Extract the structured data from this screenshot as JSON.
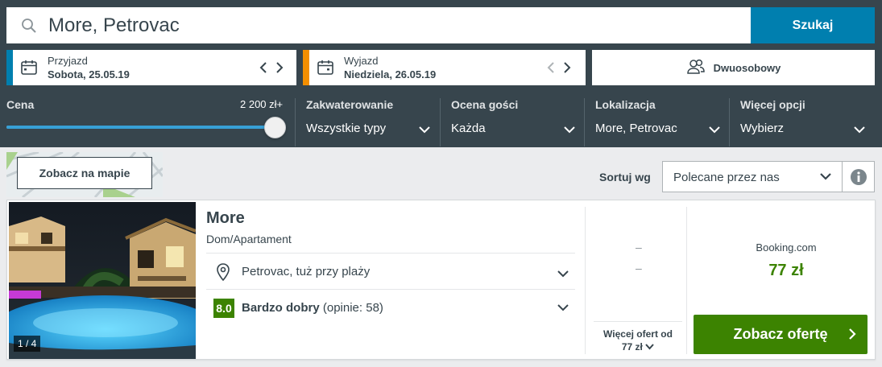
{
  "search": {
    "value": "More, Petrovac",
    "button_label": "Szukaj"
  },
  "checkin": {
    "label": "Przyjazd",
    "value": "Sobota, 25.05.19",
    "accent": "#007faf"
  },
  "checkout": {
    "label": "Wyjazd",
    "value": "Niedziela, 26.05.19",
    "accent": "#f48f00"
  },
  "room": {
    "label": "Dwuosobowy"
  },
  "filters": {
    "price": {
      "title": "Cena",
      "value": "2 200 zł+",
      "slider_level": 1.0
    },
    "accommodation": {
      "title": "Zakwaterowanie",
      "value": "Wszystkie typy"
    },
    "rating": {
      "title": "Ocena gości",
      "value": "Każda"
    },
    "location": {
      "title": "Lokalizacja",
      "value": "More, Petrovac"
    },
    "more": {
      "title": "Więcej opcji",
      "value": "Wybierz"
    }
  },
  "map": {
    "button_label": "Zobacz na mapie"
  },
  "sort": {
    "label": "Sortuj wg",
    "value": "Polecane przez nas"
  },
  "result": {
    "name": "More",
    "type": "Dom/Apartament",
    "photo_counter": "1 / 4",
    "location": "Petrovac, tuż przy plaży",
    "rating_score": "8.0",
    "rating_label": "Bardzo dobry",
    "rating_count": "(opinie: 58)",
    "alt_offers": [
      "–",
      "–"
    ],
    "more_offers_line1": "Więcej ofert od",
    "more_offers_line2": "77 zł",
    "best_site": "Booking.com",
    "best_price": "77 zł",
    "offer_button": "Zobacz ofertę"
  },
  "colors": {
    "header_bg": "#37454d",
    "accent_blue": "#007faf",
    "deal_green": "#3c8301"
  }
}
